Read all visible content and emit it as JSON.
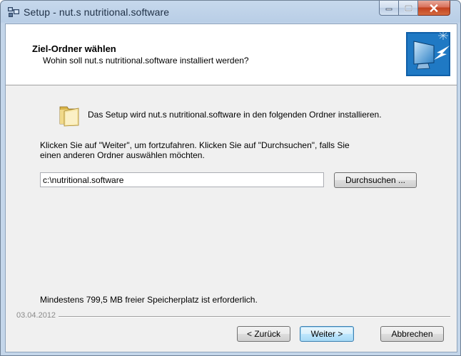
{
  "window": {
    "title": "Setup - nut.s nutritional.software",
    "icon": "setup-installer-icon"
  },
  "header": {
    "title": "Ziel-Ordner wählen",
    "subtitle": "Wohin soll nut.s nutritional.software installiert werden?",
    "image": "computer-install-arrow-image"
  },
  "main": {
    "intro": "Das Setup wird nut.s nutritional.software in den folgenden Ordner installieren.",
    "instructions_line1": "Klicken Sie auf \"Weiter\", um fortzufahren. Klicken Sie auf \"Durchsuchen\", falls Sie",
    "instructions_line2": "einen anderen Ordner auswählen möchten.",
    "path_value": "c:\\nutritional.software",
    "browse_label": "Durchsuchen ...",
    "space_required": "Mindestens 799,5 MB freier Speicherplatz ist erforderlich."
  },
  "footer": {
    "version_label": "03.04.2012",
    "back_label": "< Zurück",
    "next_label": "Weiter >",
    "cancel_label": "Abbrechen"
  }
}
